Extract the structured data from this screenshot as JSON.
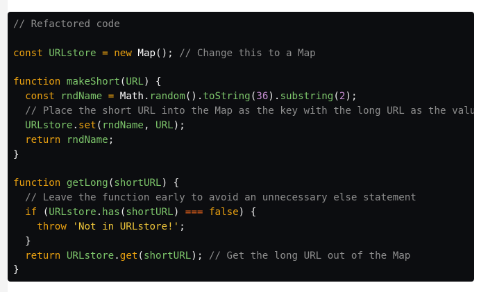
{
  "colors": {
    "background": "#0c0d10",
    "keyword": "#e9a010",
    "identifier": "#7cc46a",
    "comment": "#8e8e8e",
    "number": "#c88fd4",
    "string": "#eec53a",
    "strict_equality": "#e8621c"
  },
  "code": {
    "lines": [
      [
        [
          "// Refactored code",
          "cm"
        ]
      ],
      [],
      [
        [
          "const",
          "kw"
        ],
        [
          " ",
          "pn"
        ],
        [
          "URLstore",
          "fn"
        ],
        [
          " ",
          "pn"
        ],
        [
          "=",
          "kw"
        ],
        [
          " ",
          "pn"
        ],
        [
          "new",
          "kw"
        ],
        [
          " ",
          "pn"
        ],
        [
          "Map",
          "id"
        ],
        [
          "(); ",
          "pn"
        ],
        [
          "// Change this to a Map",
          "cm"
        ]
      ],
      [],
      [
        [
          "function",
          "kw"
        ],
        [
          " ",
          "pn"
        ],
        [
          "makeShort",
          "fn"
        ],
        [
          "(",
          "pn"
        ],
        [
          "URL",
          "fn"
        ],
        [
          ") {",
          "pn"
        ]
      ],
      [
        [
          "  ",
          "pn"
        ],
        [
          "const",
          "kw"
        ],
        [
          " ",
          "pn"
        ],
        [
          "rndName",
          "fn"
        ],
        [
          " ",
          "pn"
        ],
        [
          "=",
          "kw"
        ],
        [
          " ",
          "pn"
        ],
        [
          "Math",
          "id"
        ],
        [
          ".",
          "pn"
        ],
        [
          "random",
          "fn"
        ],
        [
          "().",
          "pn"
        ],
        [
          "toString",
          "fn"
        ],
        [
          "(",
          "pn"
        ],
        [
          "36",
          "nm"
        ],
        [
          ").",
          "pn"
        ],
        [
          "substring",
          "fn"
        ],
        [
          "(",
          "pn"
        ],
        [
          "2",
          "nm"
        ],
        [
          ");",
          "pn"
        ]
      ],
      [
        [
          "  ",
          "pn"
        ],
        [
          "// Place the short URL into the Map as the key with the long URL as the value",
          "cm"
        ]
      ],
      [
        [
          "  ",
          "pn"
        ],
        [
          "URLstore",
          "fn"
        ],
        [
          ".",
          "pn"
        ],
        [
          "set",
          "kw"
        ],
        [
          "(",
          "pn"
        ],
        [
          "rndName",
          "fn"
        ],
        [
          ", ",
          "pn"
        ],
        [
          "URL",
          "fn"
        ],
        [
          ");",
          "pn"
        ]
      ],
      [
        [
          "  ",
          "pn"
        ],
        [
          "return",
          "kw"
        ],
        [
          " ",
          "pn"
        ],
        [
          "rndName",
          "fn"
        ],
        [
          ";",
          "pn"
        ]
      ],
      [
        [
          "}",
          "pn"
        ]
      ],
      [],
      [
        [
          "function",
          "kw"
        ],
        [
          " ",
          "pn"
        ],
        [
          "getLong",
          "fn"
        ],
        [
          "(",
          "pn"
        ],
        [
          "shortURL",
          "fn"
        ],
        [
          ") {",
          "pn"
        ]
      ],
      [
        [
          "  ",
          "pn"
        ],
        [
          "// Leave the function early to avoid an unnecessary else statement",
          "cm"
        ]
      ],
      [
        [
          "  ",
          "pn"
        ],
        [
          "if",
          "kw"
        ],
        [
          " (",
          "pn"
        ],
        [
          "URLstore",
          "fn"
        ],
        [
          ".",
          "pn"
        ],
        [
          "has",
          "fn"
        ],
        [
          "(",
          "pn"
        ],
        [
          "shortURL",
          "fn"
        ],
        [
          ") ",
          "pn"
        ],
        [
          "===",
          "op"
        ],
        [
          " ",
          "pn"
        ],
        [
          "false",
          "kw"
        ],
        [
          ") {",
          "pn"
        ]
      ],
      [
        [
          "    ",
          "pn"
        ],
        [
          "throw",
          "kw"
        ],
        [
          " ",
          "pn"
        ],
        [
          "'Not in URLstore!'",
          "st"
        ],
        [
          ";",
          "pn"
        ]
      ],
      [
        [
          "  }",
          "pn"
        ]
      ],
      [
        [
          "  ",
          "pn"
        ],
        [
          "return",
          "kw"
        ],
        [
          " ",
          "pn"
        ],
        [
          "URLstore",
          "fn"
        ],
        [
          ".",
          "pn"
        ],
        [
          "get",
          "kw"
        ],
        [
          "(",
          "pn"
        ],
        [
          "shortURL",
          "fn"
        ],
        [
          "); ",
          "pn"
        ],
        [
          "// Get the long URL out of the Map",
          "cm"
        ]
      ],
      [
        [
          "}",
          "pn"
        ]
      ]
    ]
  }
}
